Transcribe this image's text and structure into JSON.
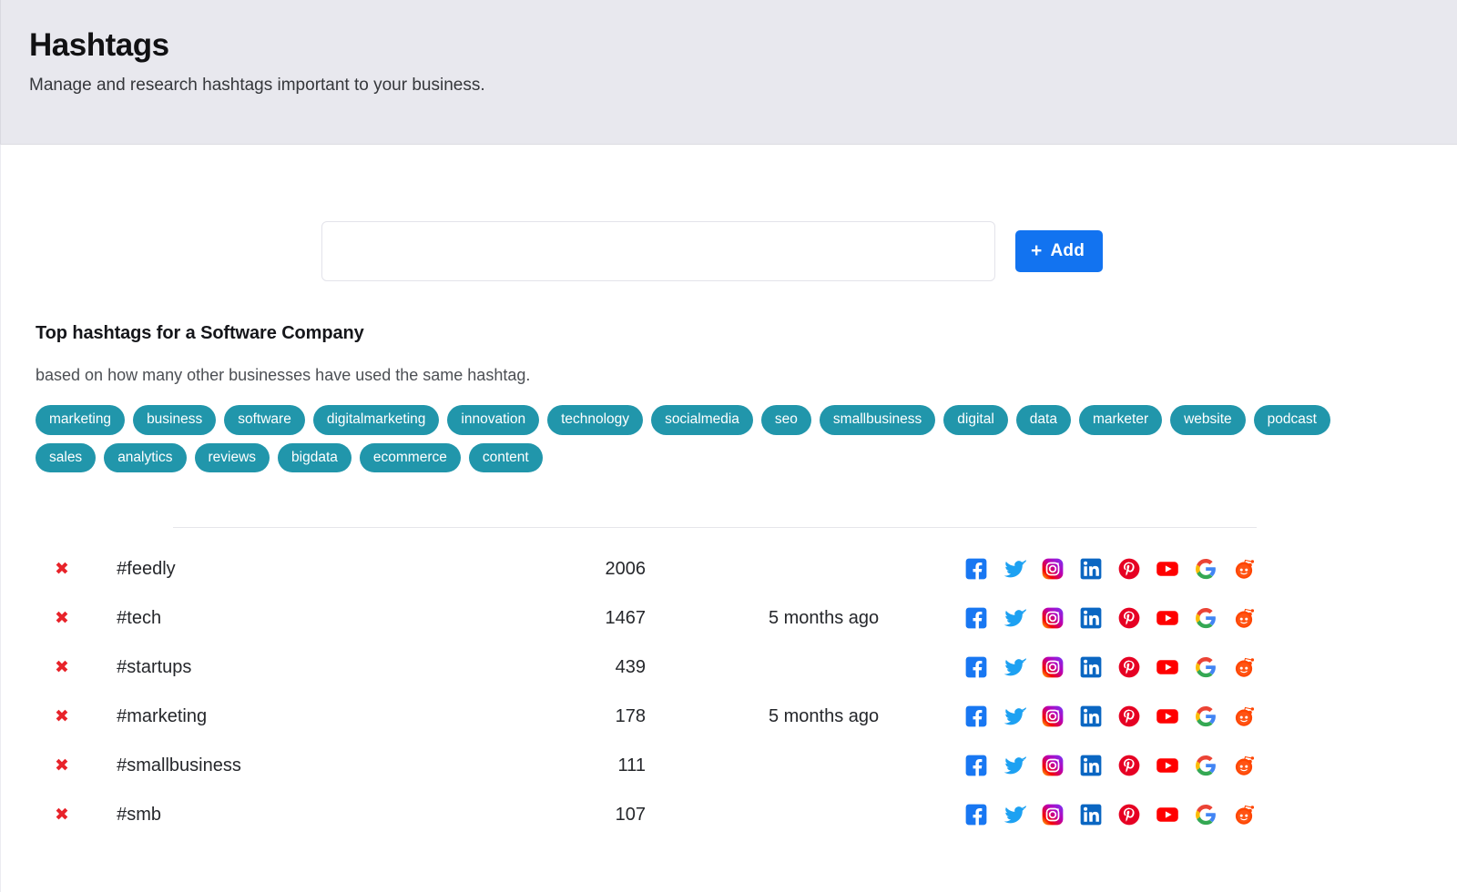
{
  "header": {
    "title": "Hashtags",
    "subtitle": "Manage and research hashtags important to your business."
  },
  "add_form": {
    "input_value": "",
    "input_placeholder": "",
    "add_label": "Add",
    "plus_glyph": "+",
    "button_color": "#1273f0"
  },
  "suggestions": {
    "title": "Top hashtags for a Software Company",
    "subtitle": "based on how many other businesses have used the same hashtag.",
    "pill_color": "#2196ab",
    "pills": [
      "marketing",
      "business",
      "software",
      "digitalmarketing",
      "innovation",
      "technology",
      "socialmedia",
      "seo",
      "smallbusiness",
      "digital",
      "data",
      "marketer",
      "website",
      "podcast",
      "sales",
      "analytics",
      "reviews",
      "bigdata",
      "ecommerce",
      "content"
    ]
  },
  "table": {
    "delete_glyph": "✖",
    "delete_color": "#e8232a",
    "rows": [
      {
        "name": "#feedly",
        "count": "2006",
        "when": ""
      },
      {
        "name": "#tech",
        "count": "1467",
        "when": "5 months ago"
      },
      {
        "name": "#startups",
        "count": "439",
        "when": ""
      },
      {
        "name": "#marketing",
        "count": "178",
        "when": "5 months ago"
      },
      {
        "name": "#smallbusiness",
        "count": "111",
        "when": ""
      },
      {
        "name": "#smb",
        "count": "107",
        "when": ""
      }
    ],
    "share_networks": [
      "facebook",
      "twitter",
      "instagram",
      "linkedin",
      "pinterest",
      "youtube",
      "google",
      "reddit"
    ]
  }
}
